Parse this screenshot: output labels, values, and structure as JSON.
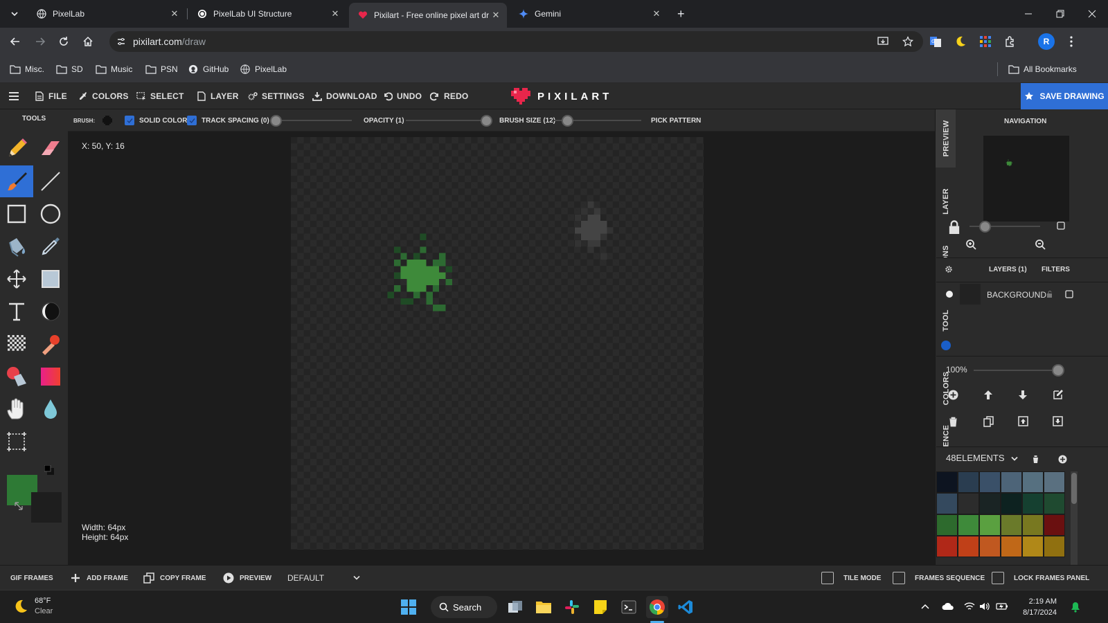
{
  "browser": {
    "tabs": [
      {
        "title": "PixelLab",
        "active": false
      },
      {
        "title": "PixelLab UI Structure",
        "active": false
      },
      {
        "title": "Pixilart - Free online pixel art dr",
        "active": true
      },
      {
        "title": "Gemini",
        "active": false
      }
    ],
    "new_tab": "+",
    "url_host": "pixilart.com",
    "url_path": "/draw",
    "profile_initial": "R",
    "bookmarks": [
      "Misc.",
      "SD",
      "Music",
      "PSN",
      "GitHub",
      "PixelLab"
    ],
    "all_bookmarks": "All Bookmarks"
  },
  "app": {
    "menu": [
      "FILE",
      "COLORS",
      "SELECT",
      "LAYER",
      "SETTINGS",
      "DOWNLOAD",
      "UNDO",
      "REDO"
    ],
    "brand": "PIXILART",
    "save_button": "SAVE DRAWING",
    "accent": "#2f6fd6",
    "brand_color": "#e8264b"
  },
  "tools": {
    "title": "TOOLS",
    "items": [
      "pencil",
      "eraser",
      "brush",
      "line",
      "rectangle",
      "ellipse",
      "bucket",
      "eyedropper",
      "move",
      "selection",
      "text",
      "shade",
      "dither",
      "stamp",
      "color-replace",
      "gradient",
      "hand",
      "blur",
      "crop"
    ],
    "active": "brush",
    "primary_color": "#2e7a35",
    "secondary_color": "#1e1e1e"
  },
  "brush_options": {
    "brush_label": "BRUSH:",
    "solid_color": "SOLID COLOR",
    "track": "TRACK",
    "spacing": "SPACING (0)",
    "opacity": "OPACITY (1)",
    "brush_size": "BRUSH SIZE (12)",
    "pick_pattern": "PICK PATTERN",
    "spacing_value": 0,
    "opacity_value": 1,
    "brush_size_value": 12
  },
  "canvas": {
    "coords": "X: 50, Y: 16",
    "width_label": "Width: 64px",
    "height_label": "Height: 64px"
  },
  "side_tabs": [
    "PREVIEW",
    "LAYER",
    "OPTIONS",
    "TOOL",
    "COLORS",
    "REFERENCE"
  ],
  "navigation": {
    "title": "NAVIGATION",
    "zoom_slider_fraction": 0.2
  },
  "layers": {
    "title": "LAYERS (1)",
    "filters": "FILTERS",
    "items": [
      {
        "name": "BACKGROUND"
      }
    ],
    "opacity": "100%"
  },
  "palette": {
    "name": "48ELEMENTS",
    "colors": [
      "#0d1420",
      "#2a3d50",
      "#3a5068",
      "#4d6478",
      "#567080",
      "#5a7080",
      "#34495e",
      "#2c2c2c",
      "#1a2424",
      "#0d2220",
      "#154030",
      "#1f4a30",
      "#2d6a2d",
      "#3e8a3a",
      "#5aa040",
      "#6a7a2a",
      "#787820",
      "#6a1010",
      "#b02818",
      "#c04018",
      "#c05820",
      "#c06818",
      "#b08818",
      "#907010"
    ]
  },
  "frames": {
    "gif_frames": "GIF FRAMES",
    "add_frame": "ADD FRAME",
    "copy_frame": "COPY FRAME",
    "preview": "PREVIEW",
    "mode": "DEFAULT",
    "tile_mode": "TILE MODE",
    "frames_sequence": "FRAMES SEQUENCE",
    "lock_frames_panel": "LOCK FRAMES PANEL"
  },
  "taskbar": {
    "weather_temp": "68°F",
    "weather_desc": "Clear",
    "search": "Search",
    "time": "2:19 AM",
    "date": "8/17/2024"
  }
}
